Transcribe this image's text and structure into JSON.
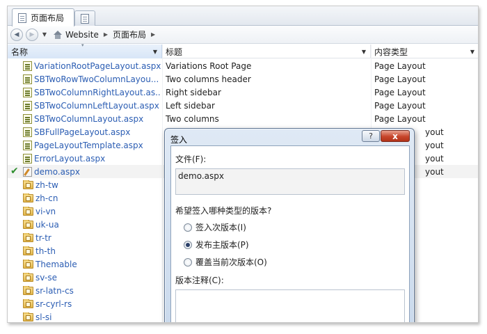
{
  "tab": {
    "label": "页面布局"
  },
  "breadcrumb": {
    "root": "Website",
    "current": "页面布局"
  },
  "columns": {
    "name": "名称",
    "title": "标题",
    "content_type": "内容类型"
  },
  "rows": [
    {
      "name": "VariationRootPageLayout.aspx",
      "title": "Variations Root Page",
      "content_type": "Page Layout",
      "icon": "page-layout-icon"
    },
    {
      "name": "SBTwoRowTwoColumnLayou...",
      "title": "Two columns header",
      "content_type": "Page Layout",
      "icon": "page-layout-icon"
    },
    {
      "name": "SBTwoColumnRightLayout.as...",
      "title": "Right sidebar",
      "content_type": "Page Layout",
      "icon": "page-layout-icon"
    },
    {
      "name": "SBTwoColumnLeftLayout.aspx",
      "title": "Left sidebar",
      "content_type": "Page Layout",
      "icon": "page-layout-icon"
    },
    {
      "name": "SBTwoColumnLayout.aspx",
      "title": "Two columns",
      "content_type": "Page Layout",
      "icon": "page-layout-icon"
    },
    {
      "name": "SBFullPageLayout.aspx",
      "title": "",
      "content_type": "yout",
      "icon": "page-layout-icon"
    },
    {
      "name": "PageLayoutTemplate.aspx",
      "title": "",
      "content_type": "yout",
      "icon": "page-layout-icon"
    },
    {
      "name": "ErrorLayout.aspx",
      "title": "",
      "content_type": "yout",
      "icon": "page-layout-icon"
    },
    {
      "name": "demo.aspx",
      "title": "",
      "content_type": "yout",
      "icon": "checked-out-page-icon",
      "checked_out": true
    },
    {
      "name": "zh-tw",
      "icon": "folder-icon"
    },
    {
      "name": "zh-cn",
      "icon": "folder-icon"
    },
    {
      "name": "vi-vn",
      "icon": "folder-icon"
    },
    {
      "name": "uk-ua",
      "icon": "folder-icon"
    },
    {
      "name": "tr-tr",
      "icon": "folder-icon"
    },
    {
      "name": "th-th",
      "icon": "folder-icon"
    },
    {
      "name": "Themable",
      "icon": "folder-icon"
    },
    {
      "name": "sv-se",
      "icon": "folder-icon"
    },
    {
      "name": "sr-latn-cs",
      "icon": "folder-icon"
    },
    {
      "name": "sr-cyrl-rs",
      "icon": "folder-icon"
    },
    {
      "name": "sl-si",
      "icon": "folder-icon"
    }
  ],
  "dialog": {
    "title": "签入",
    "help_label": "?",
    "close_label": "x",
    "file_label": "文件(F):",
    "file_value": "demo.aspx",
    "version_question": "希望签入哪种类型的版本?",
    "options": [
      {
        "label": "签入次版本(I)",
        "selected": false
      },
      {
        "label": "发布主版本(P)",
        "selected": true
      },
      {
        "label": "覆盖当前次版本(O)",
        "selected": false
      }
    ],
    "comment_label": "版本注释(C):",
    "comment_value": ""
  },
  "colors": {
    "link": "#2b5db3",
    "selected_column": "#dce8f7",
    "dialog_frame": "#c9d9ec",
    "close_button": "#c7452b"
  }
}
